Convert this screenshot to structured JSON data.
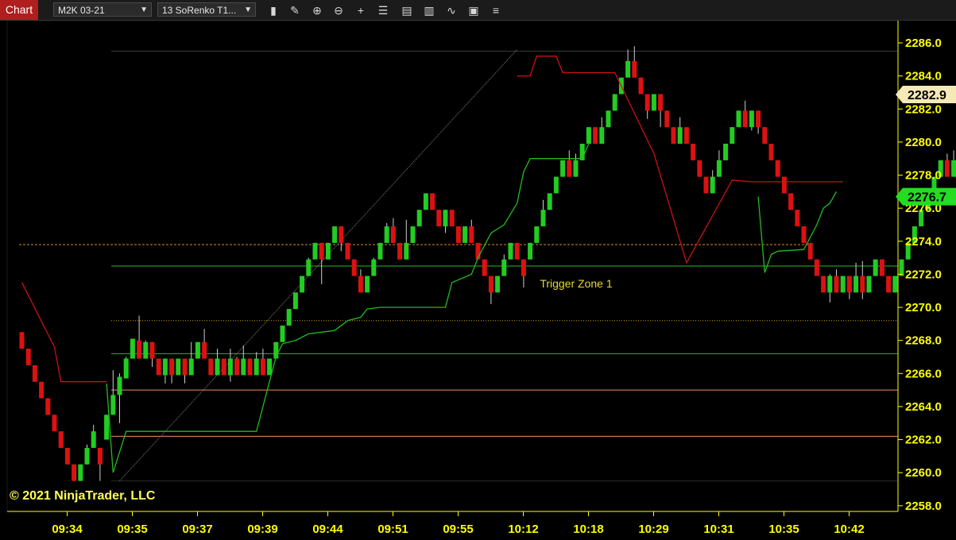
{
  "toolbar": {
    "tab_label": "Chart",
    "instrument": "M2K 03-21",
    "bar_type": "13 SoRenko T1...",
    "icons": [
      "bars-type-icon",
      "draw-tool-icon",
      "zoom-in-icon",
      "zoom-out-icon",
      "crosshair-icon",
      "properties-icon",
      "data-box-icon",
      "indicators-icon",
      "strategies-icon",
      "templates-icon",
      "menu-icon"
    ]
  },
  "colors": {
    "up": "#22cc22",
    "down": "#dd1111",
    "axis": "#ffff00",
    "signal_red": "#cc1111",
    "signal_green": "#22bb22",
    "zone_green": "#22bb22",
    "zone_orange": "#e8916a",
    "price_tag_last": "#f5e9b8",
    "price_tag_green": "#22dd22"
  },
  "watermark": "© 2021 NinjaTrader, LLC",
  "chart_data": {
    "type": "candlestick",
    "ylim": [
      2257.5,
      2286.5
    ],
    "yticks": [
      2258.0,
      2260.0,
      2262.0,
      2264.0,
      2266.0,
      2268.0,
      2270.0,
      2272.0,
      2274.0,
      2276.0,
      2278.0,
      2280.0,
      2282.0,
      2284.0,
      2286.0
    ],
    "ytick_labels": [
      "2258.0",
      "2260.0",
      "2262.0",
      "2264.0",
      "2266.0",
      "2268.0",
      "2270.0",
      "2272.0",
      "2274.0",
      "2276.0",
      "2278.0",
      "2280.0",
      "2282.0",
      "2284.0",
      "2286.0"
    ],
    "xticks": [
      "09:34",
      "09:35",
      "09:37",
      "09:39",
      "09:44",
      "09:51",
      "09:55",
      "10:12",
      "10:18",
      "10:29",
      "10:31",
      "10:35",
      "10:42"
    ],
    "xtick_bars": [
      5,
      15,
      25,
      35,
      45,
      55,
      65,
      75,
      85,
      95,
      105,
      115,
      125
    ],
    "last_price": "2282.9",
    "indicator_price": "2276.7",
    "candles": [
      [
        2268.5,
        2267.5,
        2268.5,
        2267.5
      ],
      [
        2267.5,
        2266.5,
        2267.5,
        2266.5
      ],
      [
        2266.5,
        2265.5,
        2266.5,
        2265.5
      ],
      [
        2265.5,
        2264.5,
        2265.5,
        2264.5
      ],
      [
        2264.5,
        2263.5,
        2264.5,
        2263.5
      ],
      [
        2263.5,
        2262.5,
        2263.5,
        2262.5
      ],
      [
        2262.5,
        2261.5,
        2262.5,
        2261.5
      ],
      [
        2261.5,
        2260.5,
        2261.5,
        2260.5
      ],
      [
        2260.5,
        2259.5,
        2260.5,
        2259.5
      ],
      [
        2259.5,
        2260.5,
        2260.5,
        2259.5
      ],
      [
        2260.5,
        2261.5,
        2261.7,
        2260.5
      ],
      [
        2261.5,
        2262.5,
        2262.9,
        2261.5
      ],
      [
        2261.5,
        2260.5,
        2261.5,
        2259.5
      ],
      [
        2262.0,
        2263.5,
        2263.5,
        2262.0
      ],
      [
        2263.5,
        2264.7,
        2266.2,
        2263.5
      ],
      [
        2264.7,
        2265.8,
        2266.0,
        2263.0
      ],
      [
        2265.7,
        2266.9,
        2267.0,
        2265.7
      ],
      [
        2266.9,
        2268.1,
        2268.1,
        2266.9
      ],
      [
        2268.0,
        2266.9,
        2269.5,
        2266.9
      ],
      [
        2266.9,
        2267.9,
        2268.0,
        2266.9
      ],
      [
        2267.9,
        2266.9,
        2267.9,
        2266.4
      ],
      [
        2266.9,
        2265.9,
        2266.9,
        2265.9
      ],
      [
        2265.9,
        2266.9,
        2266.9,
        2265.4
      ],
      [
        2266.9,
        2265.9,
        2266.9,
        2265.4
      ],
      [
        2265.9,
        2266.9,
        2266.9,
        2265.9
      ],
      [
        2266.9,
        2265.9,
        2266.9,
        2265.4
      ],
      [
        2265.9,
        2266.9,
        2267.9,
        2265.9
      ],
      [
        2266.9,
        2267.9,
        2267.9,
        2266.9
      ],
      [
        2267.9,
        2266.9,
        2268.7,
        2266.9
      ],
      [
        2266.9,
        2265.9,
        2266.9,
        2265.9
      ],
      [
        2265.9,
        2266.9,
        2267.5,
        2265.9
      ],
      [
        2266.9,
        2265.9,
        2266.9,
        2265.9
      ],
      [
        2265.9,
        2266.9,
        2267.5,
        2265.5
      ],
      [
        2266.9,
        2265.9,
        2267.0,
        2265.9
      ],
      [
        2265.9,
        2266.9,
        2267.7,
        2265.9
      ],
      [
        2266.9,
        2265.9,
        2266.9,
        2265.9
      ],
      [
        2265.9,
        2266.9,
        2267.3,
        2265.9
      ],
      [
        2266.9,
        2265.9,
        2267.5,
        2265.9
      ],
      [
        2265.9,
        2266.9,
        2266.9,
        2265.9
      ],
      [
        2266.9,
        2267.9,
        2267.9,
        2266.9
      ],
      [
        2267.9,
        2268.9,
        2268.9,
        2267.9
      ],
      [
        2268.9,
        2269.9,
        2269.9,
        2268.9
      ],
      [
        2269.9,
        2270.9,
        2270.9,
        2269.9
      ],
      [
        2270.9,
        2271.9,
        2271.9,
        2270.9
      ],
      [
        2271.9,
        2272.9,
        2273.0,
        2271.9
      ],
      [
        2272.9,
        2273.9,
        2273.9,
        2272.9
      ],
      [
        2273.9,
        2272.9,
        2273.9,
        2271.4
      ],
      [
        2272.9,
        2273.9,
        2273.9,
        2272.9
      ],
      [
        2273.9,
        2274.9,
        2274.9,
        2273.9
      ],
      [
        2274.9,
        2273.9,
        2274.9,
        2273.4
      ],
      [
        2273.9,
        2272.9,
        2273.9,
        2272.9
      ],
      [
        2272.9,
        2271.9,
        2272.9,
        2271.9
      ],
      [
        2271.9,
        2270.9,
        2272.3,
        2270.9
      ],
      [
        2270.9,
        2271.9,
        2271.9,
        2270.9
      ],
      [
        2271.9,
        2272.9,
        2273.0,
        2271.9
      ],
      [
        2272.9,
        2273.9,
        2273.9,
        2272.9
      ],
      [
        2273.9,
        2274.9,
        2275.1,
        2273.9
      ],
      [
        2274.9,
        2273.9,
        2275.4,
        2273.9
      ],
      [
        2273.9,
        2272.9,
        2273.9,
        2272.9
      ],
      [
        2272.9,
        2273.9,
        2275.3,
        2272.9
      ],
      [
        2273.9,
        2274.9,
        2274.9,
        2273.9
      ],
      [
        2274.9,
        2275.9,
        2275.9,
        2274.9
      ],
      [
        2275.9,
        2276.9,
        2276.9,
        2275.9
      ],
      [
        2276.9,
        2275.9,
        2276.9,
        2275.9
      ],
      [
        2275.9,
        2274.9,
        2275.9,
        2274.9
      ],
      [
        2274.9,
        2275.9,
        2275.9,
        2274.5
      ],
      [
        2275.9,
        2274.9,
        2275.9,
        2274.9
      ],
      [
        2274.9,
        2273.9,
        2274.9,
        2273.9
      ],
      [
        2273.9,
        2274.9,
        2274.9,
        2273.9
      ],
      [
        2274.9,
        2273.9,
        2275.3,
        2273.9
      ],
      [
        2273.9,
        2272.9,
        2273.9,
        2272.9
      ],
      [
        2272.9,
        2271.9,
        2272.9,
        2271.9
      ],
      [
        2271.9,
        2270.9,
        2271.9,
        2270.2
      ],
      [
        2270.9,
        2271.9,
        2271.9,
        2270.9
      ],
      [
        2271.9,
        2272.9,
        2273.2,
        2271.9
      ],
      [
        2272.9,
        2273.9,
        2273.9,
        2272.9
      ],
      [
        2273.9,
        2272.9,
        2273.9,
        2272.9
      ],
      [
        2272.9,
        2271.9,
        2272.9,
        2271.2
      ],
      [
        2272.9,
        2273.9,
        2273.9,
        2272.9
      ],
      [
        2273.9,
        2274.9,
        2274.9,
        2273.9
      ],
      [
        2274.9,
        2275.9,
        2276.5,
        2274.9
      ],
      [
        2275.9,
        2276.9,
        2276.9,
        2275.9
      ],
      [
        2276.9,
        2277.9,
        2277.9,
        2276.9
      ],
      [
        2277.9,
        2278.9,
        2278.9,
        2277.9
      ],
      [
        2278.9,
        2277.9,
        2279.5,
        2277.9
      ],
      [
        2277.9,
        2278.9,
        2279.3,
        2277.9
      ],
      [
        2278.9,
        2279.9,
        2279.9,
        2278.9
      ],
      [
        2279.9,
        2280.9,
        2280.9,
        2279.9
      ],
      [
        2280.9,
        2279.9,
        2280.9,
        2279.9
      ],
      [
        2279.9,
        2280.9,
        2281.5,
        2279.9
      ],
      [
        2280.9,
        2281.9,
        2281.9,
        2280.9
      ],
      [
        2281.9,
        2282.9,
        2282.9,
        2281.9
      ],
      [
        2282.9,
        2283.9,
        2283.9,
        2282.9
      ],
      [
        2283.9,
        2284.9,
        2285.6,
        2283.9
      ],
      [
        2284.9,
        2283.9,
        2285.8,
        2283.9
      ],
      [
        2283.9,
        2282.9,
        2283.9,
        2282.9
      ],
      [
        2282.9,
        2281.9,
        2282.9,
        2281.4
      ],
      [
        2281.9,
        2282.9,
        2282.9,
        2281.9
      ],
      [
        2282.9,
        2281.9,
        2282.9,
        2280.9
      ],
      [
        2281.9,
        2280.9,
        2281.9,
        2280.9
      ],
      [
        2280.9,
        2279.9,
        2280.9,
        2279.9
      ],
      [
        2279.9,
        2280.9,
        2281.5,
        2279.9
      ],
      [
        2280.9,
        2279.9,
        2280.9,
        2279.9
      ],
      [
        2279.9,
        2278.9,
        2279.9,
        2278.9
      ],
      [
        2278.9,
        2277.9,
        2278.9,
        2277.9
      ],
      [
        2277.9,
        2276.9,
        2277.9,
        2276.9
      ],
      [
        2276.9,
        2277.9,
        2278.3,
        2276.9
      ],
      [
        2277.9,
        2278.9,
        2279.5,
        2277.9
      ],
      [
        2278.9,
        2279.9,
        2279.9,
        2278.9
      ],
      [
        2279.9,
        2280.9,
        2280.9,
        2279.9
      ],
      [
        2280.9,
        2281.9,
        2281.9,
        2280.9
      ],
      [
        2281.9,
        2280.9,
        2282.5,
        2280.9
      ],
      [
        2280.9,
        2281.9,
        2281.9,
        2280.7
      ],
      [
        2281.9,
        2280.9,
        2281.9,
        2280.5
      ],
      [
        2280.9,
        2279.9,
        2280.9,
        2279.9
      ],
      [
        2279.9,
        2278.9,
        2279.9,
        2278.9
      ],
      [
        2278.9,
        2277.9,
        2278.9,
        2277.9
      ],
      [
        2277.9,
        2276.9,
        2277.9,
        2276.9
      ],
      [
        2276.9,
        2275.9,
        2276.9,
        2275.9
      ],
      [
        2275.9,
        2274.9,
        2275.9,
        2274.9
      ],
      [
        2274.9,
        2273.9,
        2274.9,
        2273.9
      ],
      [
        2273.9,
        2272.9,
        2273.9,
        2272.9
      ],
      [
        2272.9,
        2271.9,
        2272.9,
        2271.9
      ],
      [
        2271.9,
        2270.9,
        2271.9,
        2270.9
      ],
      [
        2270.9,
        2271.9,
        2272.0,
        2270.3
      ],
      [
        2271.9,
        2270.9,
        2272.3,
        2270.9
      ],
      [
        2270.9,
        2271.9,
        2271.9,
        2270.9
      ],
      [
        2271.9,
        2270.9,
        2271.9,
        2270.5
      ],
      [
        2270.9,
        2271.9,
        2272.7,
        2270.9
      ],
      [
        2271.9,
        2270.9,
        2272.8,
        2270.5
      ],
      [
        2270.9,
        2271.9,
        2271.9,
        2270.9
      ],
      [
        2271.9,
        2272.9,
        2272.9,
        2271.9
      ],
      [
        2272.9,
        2271.9,
        2272.9,
        2271.9
      ],
      [
        2271.9,
        2270.9,
        2271.9,
        2270.9
      ],
      [
        2270.9,
        2271.9,
        2271.9,
        2270.9
      ],
      [
        2271.9,
        2272.9,
        2272.9,
        2271.9
      ],
      [
        2272.9,
        2273.9,
        2273.9,
        2272.9
      ],
      [
        2273.9,
        2274.9,
        2274.9,
        2273.9
      ],
      [
        2274.9,
        2275.9,
        2275.9,
        2274.9
      ],
      [
        2275.9,
        2276.9,
        2276.9,
        2275.9
      ],
      [
        2276.9,
        2277.9,
        2277.9,
        2276.9
      ],
      [
        2277.9,
        2278.9,
        2278.9,
        2277.9
      ],
      [
        2278.9,
        2277.9,
        2279.3,
        2277.9
      ],
      [
        2277.9,
        2278.9,
        2279.5,
        2277.9
      ],
      [
        2278.9,
        2277.9,
        2279.4,
        2277.9
      ],
      [
        2277.9,
        2278.9,
        2279.2,
        2277.0
      ],
      [
        2278.9,
        2279.9,
        2279.9,
        2278.9
      ],
      [
        2279.9,
        2280.9,
        2280.9,
        2279.9
      ],
      [
        2280.9,
        2281.9,
        2281.9,
        2280.9
      ],
      [
        2281.9,
        2282.9,
        2282.9,
        2281.9
      ],
      [
        2282.9,
        2281.9,
        2282.9,
        2281.4
      ],
      [
        2281.9,
        2282.9,
        2283.0,
        2281.9
      ],
      [
        2282.9,
        2282.9,
        2283.6,
        2282.9
      ]
    ],
    "signal_red": [
      [
        0,
        2271.5
      ],
      [
        5,
        2267.6
      ],
      [
        6,
        2265.5
      ],
      [
        13,
        2265.5
      ]
    ],
    "signal_red_2": [
      [
        76,
        2284.0
      ],
      [
        78,
        2284.0
      ],
      [
        79,
        2285.2
      ],
      [
        82,
        2285.2
      ],
      [
        83,
        2284.2
      ],
      [
        91,
        2284.2
      ],
      [
        97,
        2279.3
      ],
      [
        102,
        2272.7
      ],
      [
        109,
        2277.7
      ],
      [
        112,
        2277.6
      ],
      [
        126,
        2277.6
      ]
    ],
    "signal_green": [
      [
        13,
        2265.4
      ],
      [
        14,
        2260.0
      ],
      [
        16,
        2262.5
      ],
      [
        36,
        2262.5
      ],
      [
        38,
        2265.5
      ],
      [
        39,
        2267.0
      ],
      [
        40,
        2267.8
      ],
      [
        42,
        2268.0
      ],
      [
        44,
        2268.4
      ],
      [
        48,
        2268.6
      ],
      [
        50,
        2269.2
      ],
      [
        52,
        2269.4
      ],
      [
        53,
        2269.9
      ],
      [
        55,
        2270.0
      ],
      [
        65,
        2270.0
      ],
      [
        66,
        2271.5
      ],
      [
        69,
        2272.0
      ],
      [
        70,
        2273.0
      ],
      [
        72,
        2274.5
      ],
      [
        74,
        2275.0
      ],
      [
        76,
        2276.3
      ],
      [
        77,
        2278.2
      ],
      [
        78,
        2279.0
      ],
      [
        86,
        2279.0
      ],
      [
        87,
        2279.9
      ]
    ],
    "signal_green_2": [
      [
        113,
        2276.7
      ],
      [
        114,
        2272.1
      ],
      [
        115,
        2273.2
      ],
      [
        116,
        2273.4
      ],
      [
        120,
        2273.5
      ],
      [
        122,
        2275.0
      ],
      [
        123,
        2276.0
      ],
      [
        124,
        2276.3
      ],
      [
        125,
        2277.0
      ]
    ],
    "zones": [
      {
        "price": 2285.5,
        "color": "#3a3a3a"
      },
      {
        "price": 2272.5,
        "color": "#22bb22",
        "label": "Trigger Zone 1"
      },
      {
        "price": 2269.2,
        "color": "#d0a020",
        "dotted": true
      },
      {
        "price": 2267.2,
        "color": "#22bb22"
      },
      {
        "price": 2265.0,
        "color": "#e8916a"
      },
      {
        "price": 2262.2,
        "color": "#e8916a"
      },
      {
        "price": 2259.5,
        "color": "#2a2a2a"
      }
    ],
    "dashed_level": {
      "price": 2273.8,
      "color": "#d08a3a"
    },
    "trendline": [
      [
        15,
        2259.5
      ],
      [
        76,
        2285.6
      ]
    ]
  }
}
